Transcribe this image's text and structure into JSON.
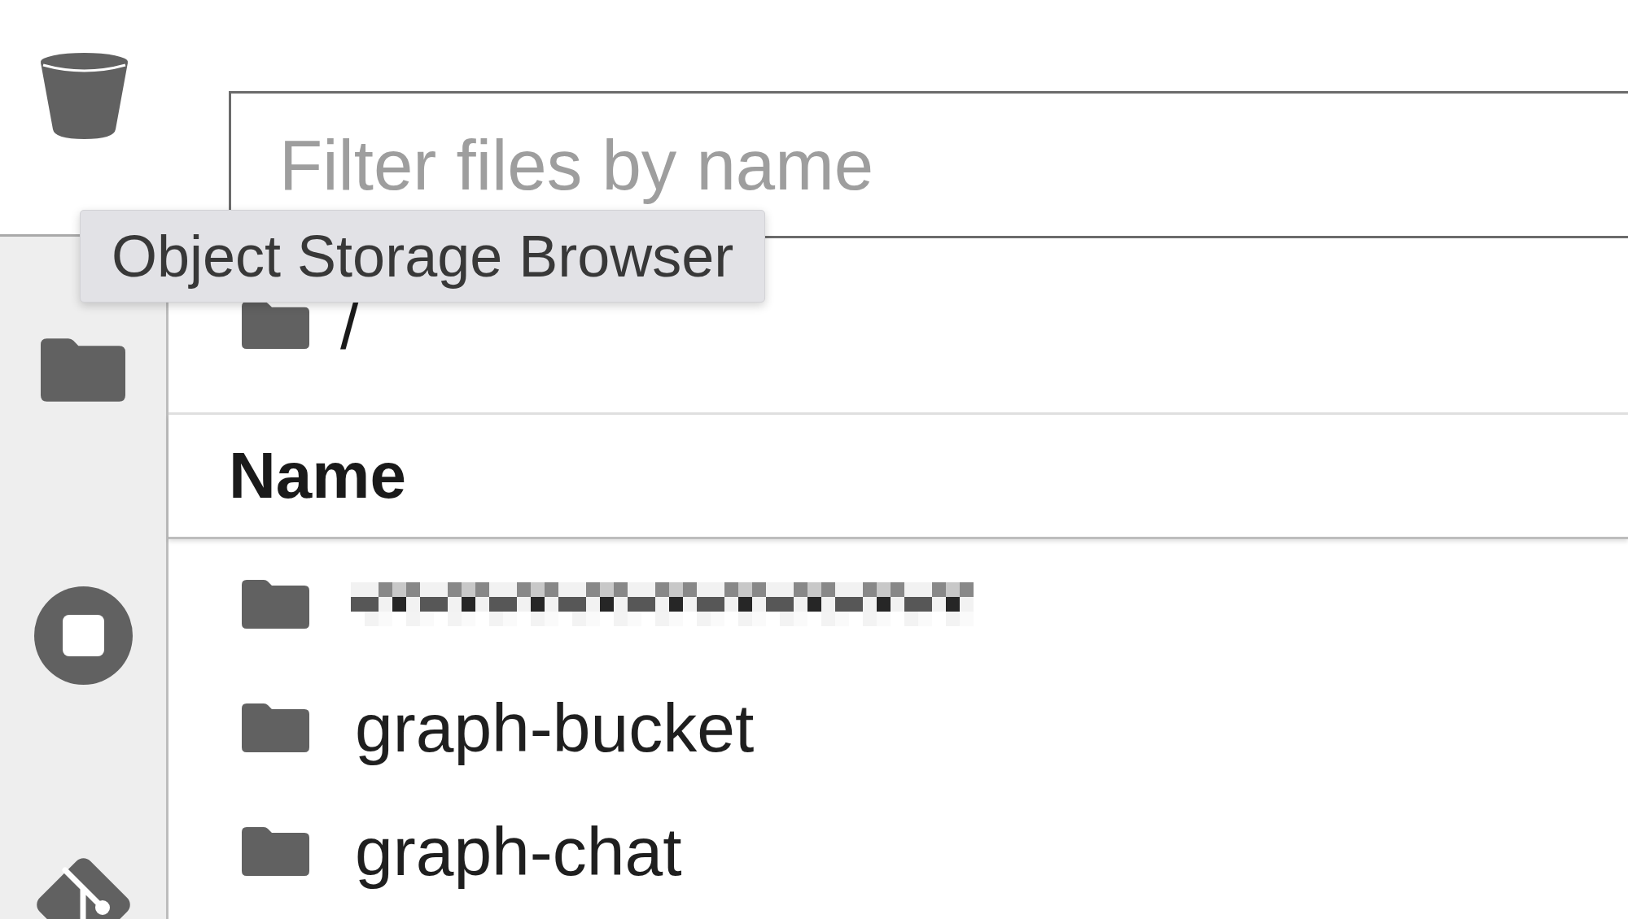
{
  "sidebar": {
    "tabs": [
      {
        "kind": "bucket",
        "selected": true
      },
      {
        "kind": "folder",
        "selected": false
      },
      {
        "kind": "running",
        "selected": false
      },
      {
        "kind": "git",
        "selected": false
      }
    ]
  },
  "tooltip": {
    "text": "Object Storage Browser"
  },
  "filter": {
    "placeholder": "Filter files by name"
  },
  "breadcrumb": {
    "path": "/"
  },
  "file_list": {
    "columns": [
      {
        "label": "Name"
      }
    ],
    "rows": [
      {
        "redacted": true
      },
      {
        "name": "graph-bucket",
        "redacted": false
      },
      {
        "name": "graph-chat",
        "redacted": false
      }
    ]
  }
}
